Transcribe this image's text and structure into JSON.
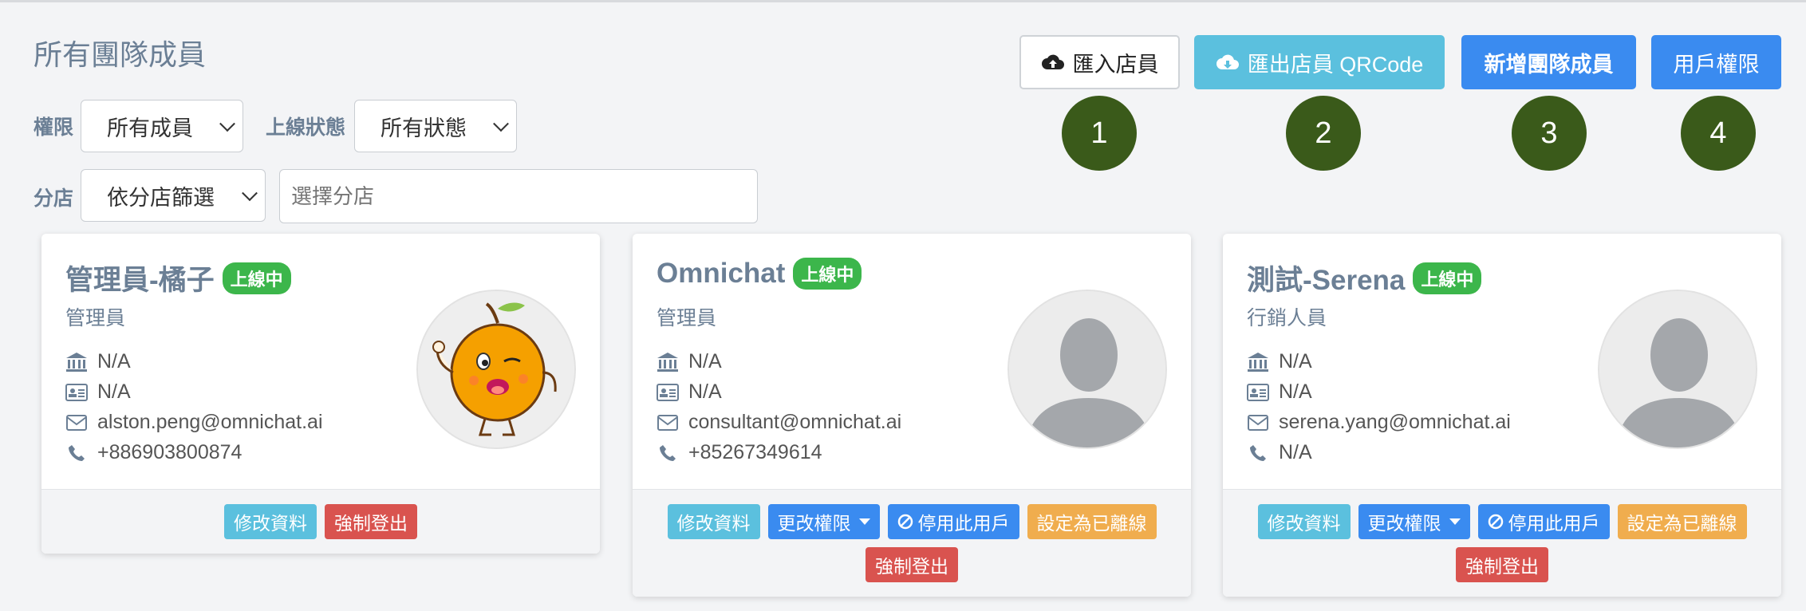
{
  "page": {
    "title": "所有團隊成員"
  },
  "filters": {
    "permission_label": "權限",
    "permission_value": "所有成員",
    "status_label": "上線狀態",
    "status_value": "所有狀態",
    "branch_label": "分店",
    "branch_filter_value": "依分店篩選",
    "branch_input_placeholder": "選擇分店"
  },
  "toolbar": {
    "import_label": "匯入店員",
    "export_label": "匯出店員 QRCode",
    "add_label": "新增團隊成員",
    "permissions_label": "用戶權限"
  },
  "markers": [
    "1",
    "2",
    "3",
    "4"
  ],
  "cards": [
    {
      "name": "管理員-橘子",
      "status": "上線中",
      "role": "管理員",
      "branch": "N/A",
      "id": "N/A",
      "email": "alston.peng@omnichat.ai",
      "phone": "+886903800874",
      "buttons": {
        "edit": "修改資料",
        "logout": "強制登出"
      }
    },
    {
      "name": "Omnichat",
      "status": "上線中",
      "role": "管理員",
      "branch": "N/A",
      "id": "N/A",
      "email": "consultant@omnichat.ai",
      "phone": "+85267349614",
      "buttons": {
        "edit": "修改資料",
        "perm": "更改權限",
        "disable": "停用此用戶",
        "offline": "設定為已離線",
        "logout": "強制登出"
      }
    },
    {
      "name": "測試-Serena",
      "status": "上線中",
      "role": "行銷人員",
      "branch": "N/A",
      "id": "N/A",
      "email": "serena.yang@omnichat.ai",
      "phone": "N/A",
      "buttons": {
        "edit": "修改資料",
        "perm": "更改權限",
        "disable": "停用此用戶",
        "offline": "設定為已離線",
        "logout": "強制登出"
      }
    }
  ],
  "colors": {
    "primary": "#3a8bf0",
    "info": "#5bc0de",
    "danger": "#d9534f",
    "warning": "#f0ad4e",
    "success": "#3cb64b",
    "marker": "#3a5a1a"
  }
}
